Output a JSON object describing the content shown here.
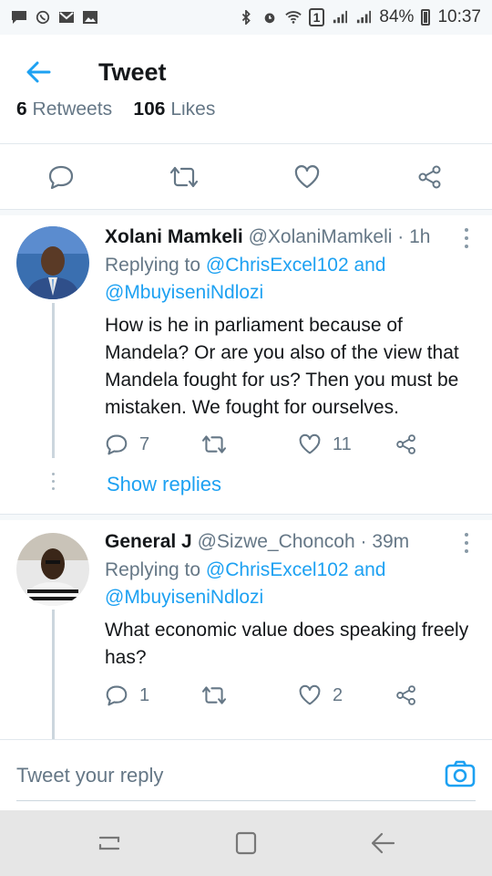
{
  "status_bar": {
    "battery": "84%",
    "time": "10:37",
    "sim_badge": "1"
  },
  "header": {
    "title": "Tweet"
  },
  "stats": {
    "retweets_count": "6",
    "retweets_label": "Retweets",
    "likes_count": "106",
    "likes_label": "Likes"
  },
  "replies": [
    {
      "name": "Xolani Mamkeli",
      "handle": "@XolaniMamkeli · 1h",
      "replying_prefix": "Replying to",
      "replying_to": "@ChrisExcel102 and @MbuyiseniNdlozi",
      "text": "How is he in parliament because of Mandela? Or are you also of the view that Mandela fought for us? Then you must be mistaken. We fought for ourselves.",
      "reply_count": "7",
      "retweet_count": "",
      "like_count": "11",
      "show_replies": "Show replies"
    },
    {
      "name": "General J",
      "handle": "@Sizwe_Choncoh · 39m",
      "replying_prefix": "Replying to",
      "replying_to": "@ChrisExcel102 and @MbuyiseniNdlozi",
      "text": "What economic value does speaking freely has?",
      "reply_count": "1",
      "retweet_count": "",
      "like_count": "2"
    }
  ],
  "composer": {
    "placeholder": "Tweet your reply"
  },
  "colors": {
    "accent": "#1da1f2",
    "secondary_text": "#657786",
    "divider": "#e1e8ed"
  }
}
